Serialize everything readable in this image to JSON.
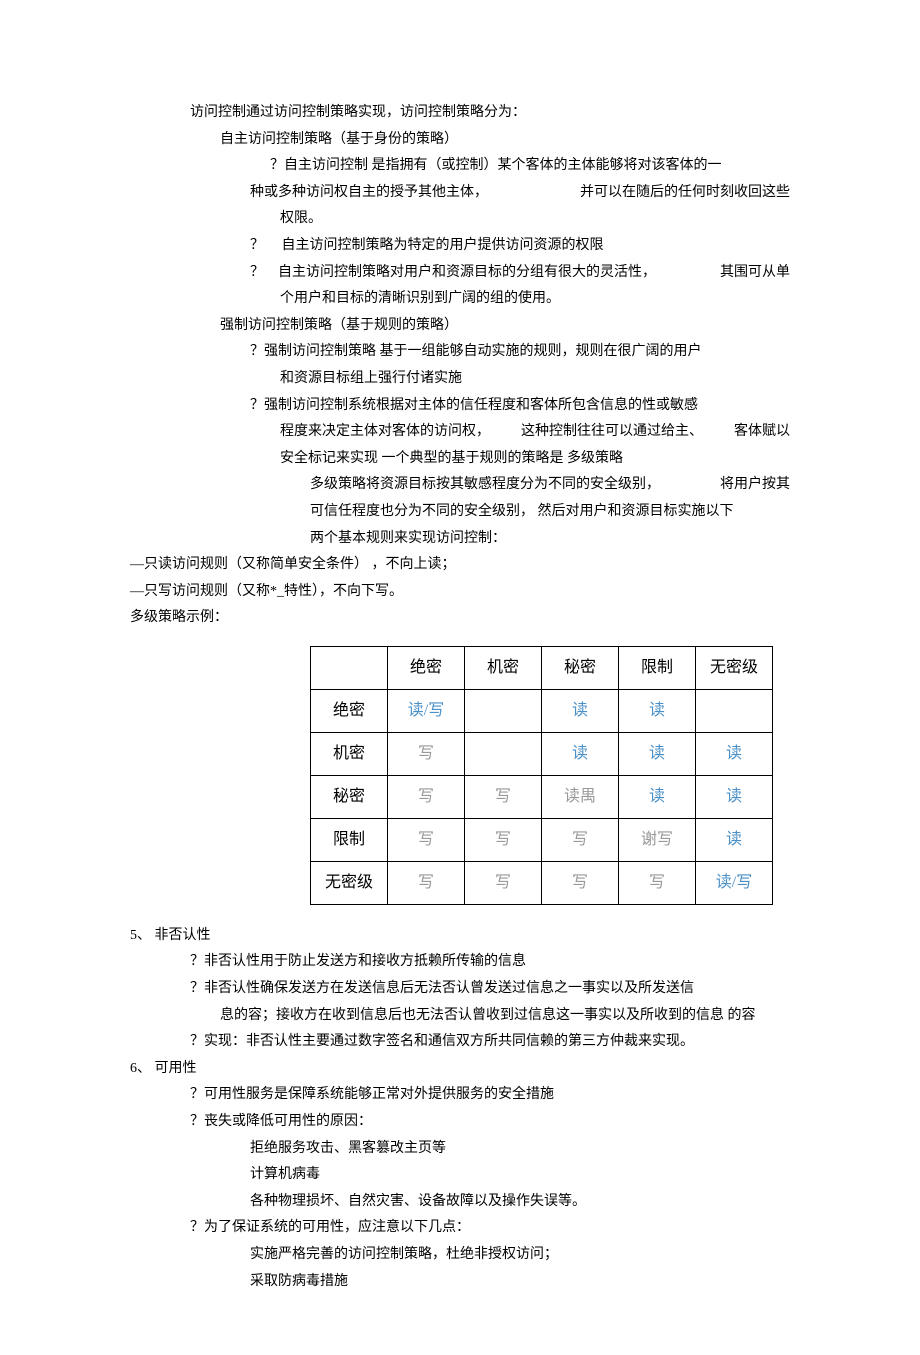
{
  "p1": "访问控制通过访问控制策略实现，访问控制策略分为：",
  "p2": "自主访问控制策略（基于身份的策略）",
  "p3a": "？自主访问控制  是指拥有（或控制）某个客体的主体能够将对该客体的一",
  "p3b_1": "种或多种访问权自主的授予其他主体，",
  "p3b_2": "并可以在随后的任何时刻收回这些",
  "p3c": "权限。",
  "p4_1": "？",
  "p4_2": "自主访问控制策略为特定的用户提供访问资源的权限",
  "p5a_1": "？",
  "p5a_2": "自主访问控制策略对用户和资源目标的分组有很大的灵活性，",
  "p5a_3": "其围可从单",
  "p5b": "个用户和目标的清晰识别到广阔的组的使用。",
  "p6": "强制访问控制策略（基于规则的策略）",
  "p7a": "？强制访问控制策略  基于一组能够自动实施的规则，规则在很广阔的用户",
  "p7b": "和资源目标组上强行付诸实施",
  "p8a": "？强制访问控制系统根据对主体的信任程度和客体所包含信息的性或敏感",
  "p8b_1": "程度来决定主体对客体的访问权，",
  "p8b_2": "这种控制往往可以通过给主、",
  "p8b_3": "客体赋以",
  "p8c": "安全标记来实现   一个典型的基于规则的策略是  多级策略",
  "p9a_1": "多级策略将资源目标按其敏感程度分为不同的安全级别，",
  "p9a_2": "将用户按其",
  "p9b": "可信任程度也分为不同的安全级别，   然后对用户和资源目标实施以下",
  "p9c": "两个基本规则来实现访问控制：",
  "r1": "—只读访问规则（又称简单安全条件）       ，不向上读；",
  "r2": "—只写访问规则（又称*_特性），不向下写。",
  "r3": "多级策略示例：",
  "table": {
    "cols": [
      "",
      "绝密",
      "机密",
      "秘密",
      "限制",
      "无密级"
    ],
    "rows": [
      {
        "h": "绝密",
        "c": [
          "读/写",
          "",
          "读",
          "读",
          ""
        ]
      },
      {
        "h": "机密",
        "c": [
          "写",
          "",
          "读",
          "读",
          "读"
        ]
      },
      {
        "h": "秘密",
        "c": [
          "写",
          "写",
          "读禺",
          "读",
          "读"
        ]
      },
      {
        "h": "限制",
        "c": [
          "写",
          "写",
          "写",
          "谢写",
          "读"
        ]
      },
      {
        "h": "无密级",
        "c": [
          "写",
          "写",
          "写",
          "写",
          "读/写"
        ]
      }
    ]
  },
  "s5_h": "5、 非否认性",
  "s5_1": "？非否认性用于防止发送方和接收方抵赖所传输的信息",
  "s5_2a": "？非否认性确保发送方在发送信息后无法否认曾发送过信息之一事实以及所发送信",
  "s5_2b": "息的容；接收方在收到信息后也无法否认曾收到过信息这一事实以及所收到的信息  的容",
  "s5_3": "？实现：非否认性主要通过数字签名和通信双方所共同信赖的第三方仲裁来实现。",
  "s6_h": "6、 可用性",
  "s6_1": "？可用性服务是保障系统能够正常对外提供服务的安全措施",
  "s6_2": "？丧失或降低可用性的原因：",
  "s6_2a": "拒绝服务攻击、黑客篡改主页等",
  "s6_2b": "计算机病毒",
  "s6_2c": "各种物理损坏、自然灾害、设备故障以及操作失误等。",
  "s6_3": "？为了保证系统的可用性，应注意以下几点：",
  "s6_3a": "实施严格完善的访问控制策略，杜绝非授权访问；",
  "s6_3b": "采取防病毒措施"
}
